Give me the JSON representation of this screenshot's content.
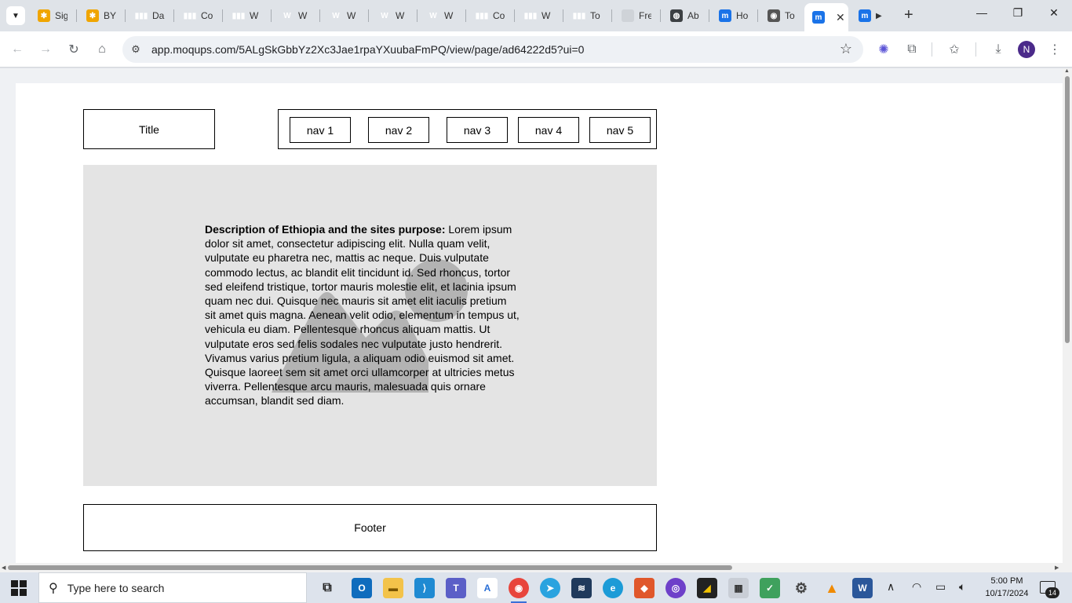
{
  "browser": {
    "tabs": [
      {
        "label": "Sig",
        "icon": "yellow-circle-icon"
      },
      {
        "label": "BY",
        "icon": "yellow-circle-icon"
      },
      {
        "label": "Da",
        "icon": "bar-chart-icon"
      },
      {
        "label": "Co",
        "icon": "bar-chart-icon"
      },
      {
        "label": "W",
        "icon": "bar-chart-icon"
      },
      {
        "label": "W",
        "icon": "w-logo-icon"
      },
      {
        "label": "W",
        "icon": "w-logo-icon"
      },
      {
        "label": "W",
        "icon": "w-logo-icon"
      },
      {
        "label": "W",
        "icon": "w-logo-icon"
      },
      {
        "label": "Co",
        "icon": "bar-chart-icon"
      },
      {
        "label": "W",
        "icon": "bar-chart-icon"
      },
      {
        "label": "To",
        "icon": "bar-chart-icon"
      },
      {
        "label": "Fre",
        "icon": "pin-icon"
      },
      {
        "label": "Ab",
        "icon": "globe-icon"
      },
      {
        "label": "Ho",
        "icon": "moqups-icon"
      },
      {
        "label": "To",
        "icon": "chrome-icon"
      },
      {
        "label": "",
        "icon": "moqups-icon",
        "active": true
      },
      {
        "label": "",
        "icon": "moqups-icon"
      }
    ],
    "close_glyph": "✕",
    "new_tab_glyph": "+",
    "url": "app.moqups.com/5ALgSkGbbYz2Xc3Jae1rpaYXuubaFmPQ/view/page/ad64222d5?ui=0",
    "avatar_letter": "N",
    "colors": {
      "accent": "#1a73e8",
      "avatar": "#4b2a8a"
    }
  },
  "page": {
    "title": "Title",
    "nav": [
      "nav 1",
      "nav 2",
      "nav 3",
      "nav 4",
      "nav 5"
    ],
    "description_heading": "Description of Ethiopia and the sites purpose:",
    "description_body": " Lorem ipsum dolor sit amet, consectetur adipiscing elit. Nulla quam velit, vulputate eu pharetra nec, mattis ac neque. Duis vulputate commodo lectus, ac blandit elit tincidunt id. Sed rhoncus, tortor sed eleifend tristique, tortor mauris molestie elit, et lacinia ipsum quam nec dui. Quisque nec mauris sit amet elit iaculis pretium sit amet quis magna. Aenean velit odio, elementum in tempus ut, vehicula eu diam. Pellentesque rhoncus aliquam mattis. Ut vulputate eros sed felis sodales nec vulputate justo hendrerit. Vivamus varius pretium ligula, a aliquam odio euismod sit amet. Quisque laoreet sem sit amet orci ullamcorper at ultricies metus viverra. Pellentesque arcu mauris, malesuada quis ornare accumsan, blandit sed diam.",
    "footer": "Footer",
    "colors": {
      "hero_bg": "#e4e4e4",
      "placeholder": "#b3b3b3"
    }
  },
  "taskbar": {
    "search_placeholder": "Type here to search",
    "time": "5:00 PM",
    "date": "10/17/2024",
    "notification_count": "14"
  }
}
